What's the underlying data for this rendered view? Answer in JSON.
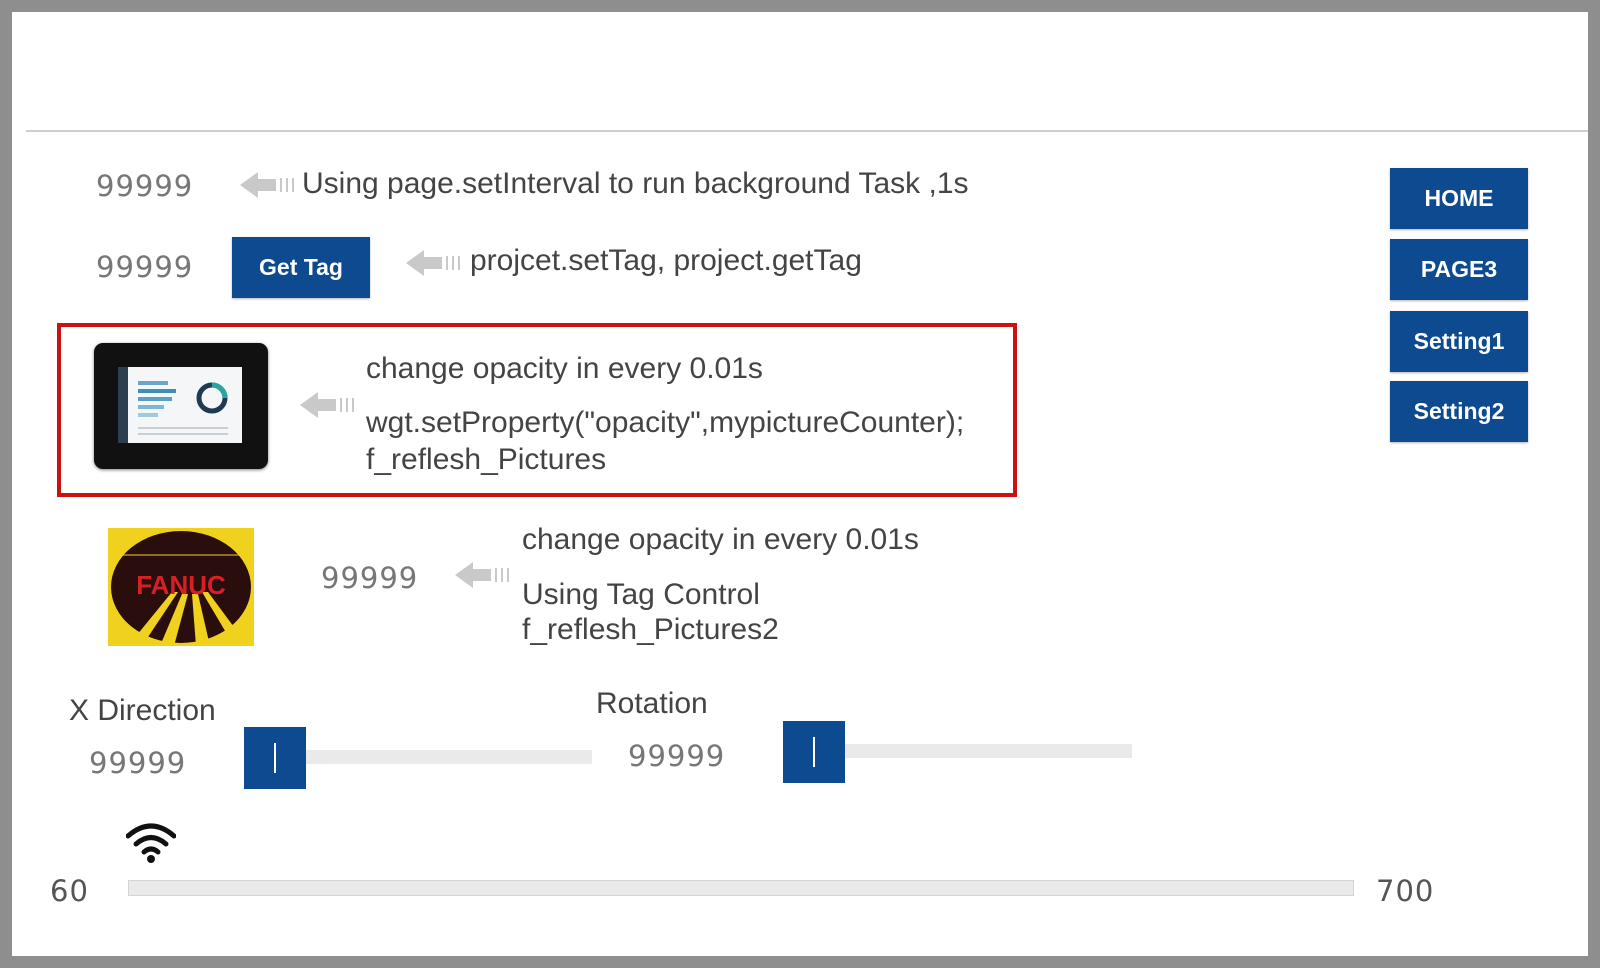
{
  "row1": {
    "value": "99999",
    "text": "Using page.setInterval to run background Task ,1s"
  },
  "row2": {
    "value": "99999",
    "button_label": "Get Tag",
    "text": "projcet.setTag, project.getTag"
  },
  "row3": {
    "line1": "change opacity in every 0.01s",
    "line2": "wgt.setProperty(\"opacity\",mypictureCounter);",
    "line3": "f_reflesh_Pictures"
  },
  "row4": {
    "value": "99999",
    "logo_text": "FANUC",
    "line1": "change opacity in every 0.01s",
    "line2": "Using Tag Control",
    "line3": "f_reflesh_Pictures2"
  },
  "x_direction": {
    "label": "X Direction",
    "value": "99999",
    "slider_level": 0
  },
  "rotation": {
    "label": "Rotation",
    "value": "99999",
    "slider_level": 0
  },
  "nav": {
    "home": "HOME",
    "page3": "PAGE3",
    "setting1": "Setting1",
    "setting2": "Setting2"
  },
  "signal": {
    "icon": "wifi-icon",
    "min_label": "60",
    "max_label": "700"
  },
  "colors": {
    "accent": "#0d4a8f",
    "highlight": "#cc1111",
    "logo_yellow": "#f0d21e",
    "logo_red": "#d81f26"
  }
}
